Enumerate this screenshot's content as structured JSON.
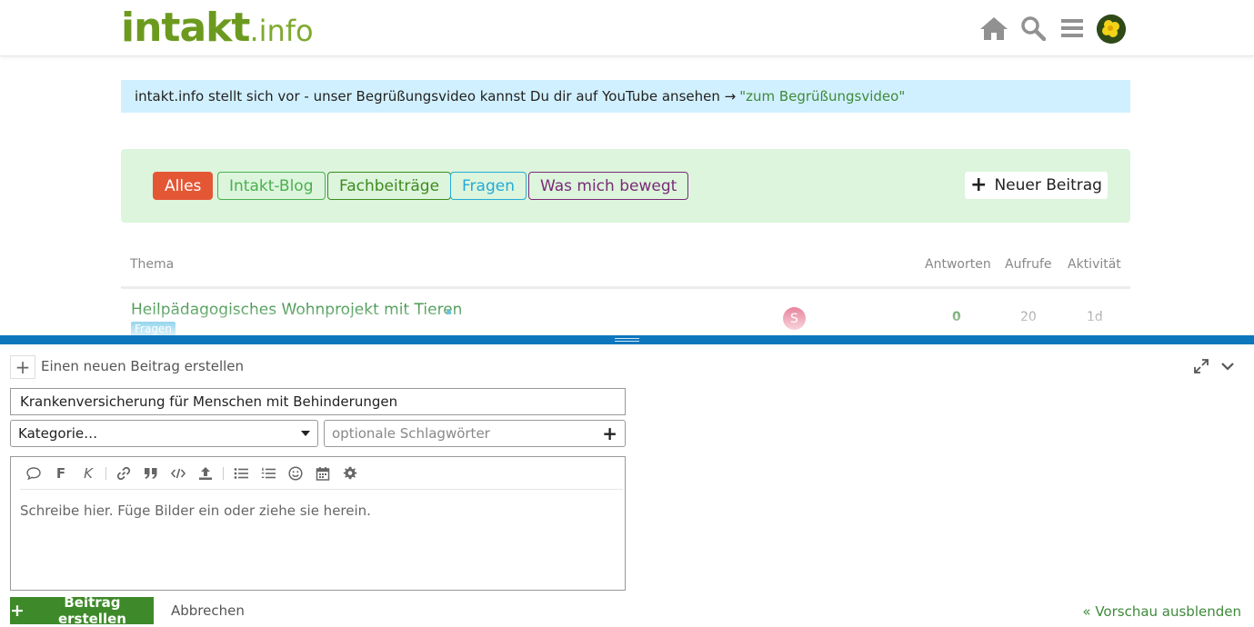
{
  "header": {
    "logo_main": "intakt",
    "logo_suffix": ".info",
    "icons": [
      "home-icon",
      "search-icon",
      "hamburger-menu-icon",
      "user-avatar"
    ]
  },
  "banner": {
    "text": "intakt.info stellt sich vor - unser Begrüßungsvideo kannst Du dir auf YouTube ansehen →",
    "link_text": "\"zum Begrüßungsvideo\""
  },
  "categories": {
    "chips": [
      {
        "label": "Alles",
        "color": "#e45735"
      },
      {
        "label": "Intakt-Blog",
        "color": "#4caf50"
      },
      {
        "label": "Fachbeiträge",
        "color": "#3f8a1f"
      },
      {
        "label": "Fragen",
        "color": "#25aad8"
      },
      {
        "label": "Was mich bewegt",
        "color": "#7b2a78"
      }
    ],
    "new_post_label": "Neuer Beitrag"
  },
  "topic_list": {
    "columns": {
      "topic": "Thema",
      "replies": "Antworten",
      "views": "Aufrufe",
      "activity": "Aktivität"
    },
    "rows": [
      {
        "title": "Heilpädagogisches Wohnprojekt mit Tieren",
        "category": "Fragen",
        "poster_initial": "S",
        "replies": "0",
        "views": "20",
        "activity": "1d"
      }
    ]
  },
  "composer": {
    "action_label": "Einen neuen Beitrag erstellen",
    "title_value": "Krankenversicherung für Menschen mit Behinderungen",
    "category_placeholder": "Kategorie…",
    "tags_placeholder": "optionale Schlagwörter",
    "toolbar_icons": [
      "quote-bubble-icon",
      "bold-icon",
      "italic-icon",
      "link-icon",
      "blockquote-icon",
      "code-icon",
      "upload-icon",
      "bullet-list-icon",
      "numbered-list-icon",
      "emoji-icon",
      "calendar-icon",
      "gear-icon"
    ],
    "bold_glyph": "F",
    "italic_glyph": "K",
    "editor_placeholder": "Schreibe hier. Füge Bilder ein oder ziehe sie herein.",
    "submit_label": "Beitrag erstellen",
    "cancel_label": "Abbrechen",
    "preview_toggle_label": "« Vorschau ausblenden"
  },
  "colors": {
    "brand_green": "#3e8a2a",
    "composer_blue": "#0e76bd",
    "banner_bg": "#d1f0ff",
    "category_panel_bg": "#dcf5dc"
  }
}
